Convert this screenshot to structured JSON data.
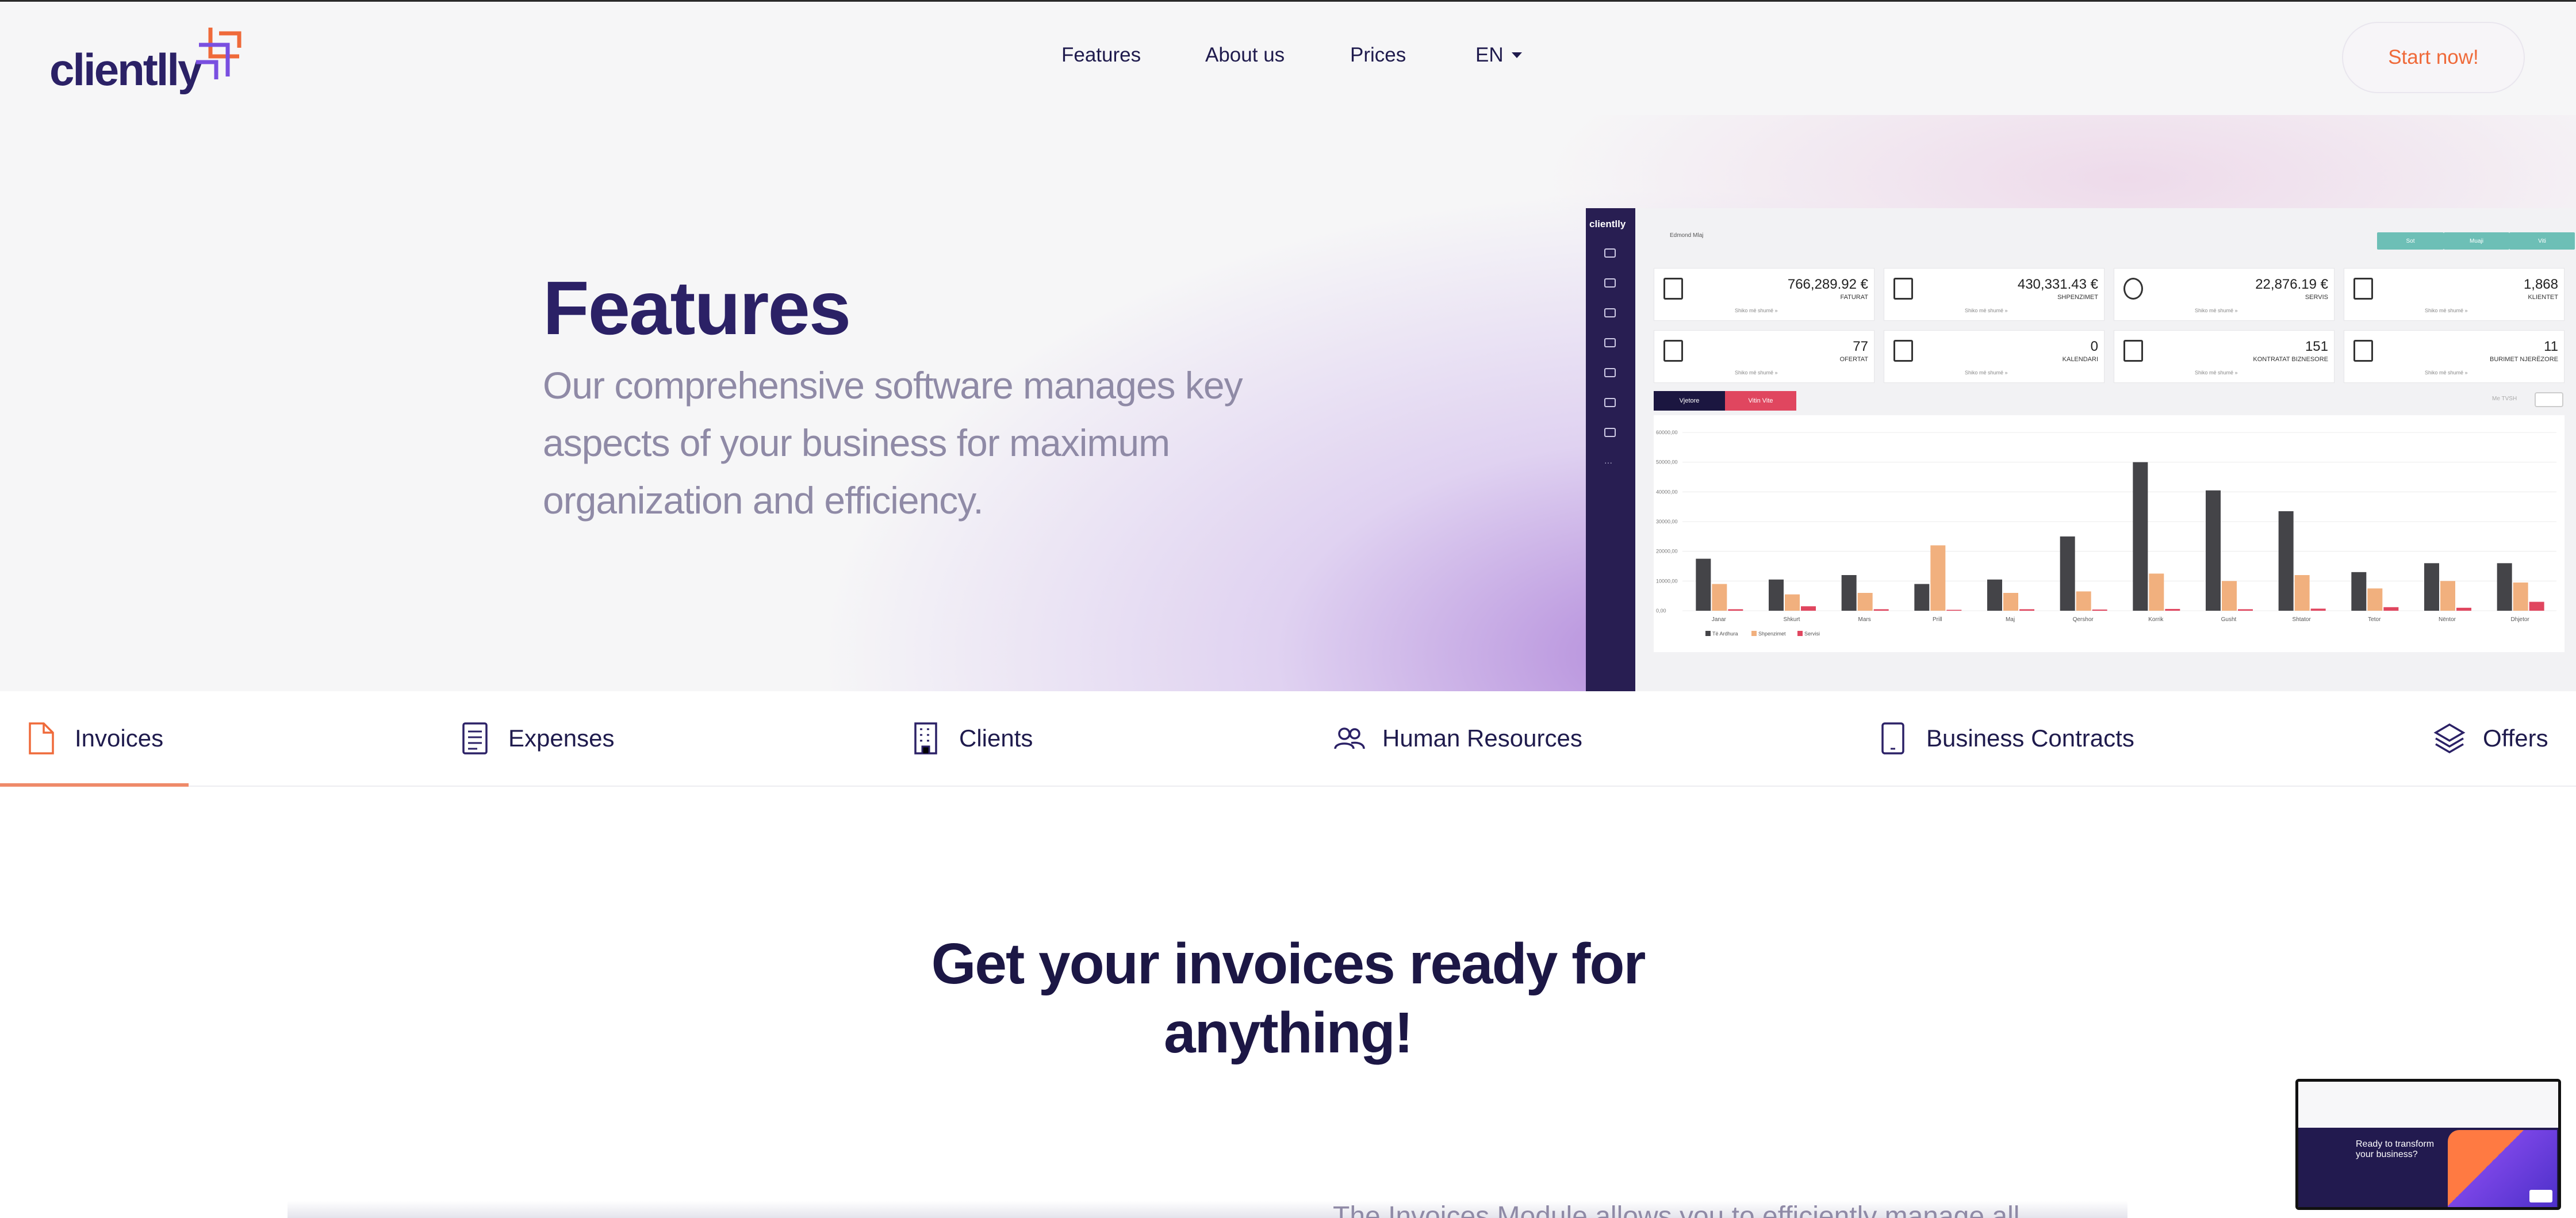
{
  "header": {
    "logo_text": "clientlly",
    "nav": [
      "Features",
      "About us",
      "Prices"
    ],
    "language": "EN",
    "cta_label": "Start now!"
  },
  "hero": {
    "title": "Features",
    "subtitle": "Our comprehensive software manages key aspects of your business for maximum organization and efficiency."
  },
  "dashboard": {
    "logo_text": "clientlly",
    "user_name": "Edmond Mlaj",
    "top_buttons": [
      "Sot",
      "Muaji",
      "Viti"
    ],
    "stats": [
      {
        "value": "766,289.92 €",
        "label": "FATURAT",
        "link": "Shiko më shumë »",
        "icon": "invoice-icon"
      },
      {
        "value": "430,331.43 €",
        "label": "SHPENZIMET",
        "link": "Shiko më shumë »",
        "icon": "wallet-icon"
      },
      {
        "value": "22,876.19 €",
        "label": "SERVIS",
        "link": "Shiko më shumë »",
        "icon": "gear-icon"
      },
      {
        "value": "1,868",
        "label": "KLIENTET",
        "link": "Shiko më shumë »",
        "icon": "building-icon"
      },
      {
        "value": "77",
        "label": "OFERTAT",
        "link": "Shiko më shumë »",
        "icon": "offer-icon"
      },
      {
        "value": "0",
        "label": "KALENDARI",
        "link": "Shiko më shumë »",
        "icon": "calendar-icon"
      },
      {
        "value": "151",
        "label": "KONTRATAT BIZNESORE",
        "link": "Shiko më shumë »",
        "icon": "contract-icon"
      },
      {
        "value": "11",
        "label": "BURIMET NJERËZORE",
        "link": "Shiko më shumë »",
        "icon": "id-card-icon"
      }
    ],
    "tabs": [
      "Vjetore",
      "Vitin Vite"
    ],
    "toggle_label": "Me TVSH"
  },
  "chart_data": {
    "type": "bar",
    "categories": [
      "Janar",
      "Shkurt",
      "Mars",
      "Prill",
      "Maj",
      "Qershor",
      "Korrik",
      "Gusht",
      "Shtator",
      "Tetor",
      "Nëntor",
      "Dhjetor"
    ],
    "y_ticks": [
      "0,00",
      "10000,00",
      "20000,00",
      "30000,00",
      "40000,00",
      "50000,00",
      "60000,00"
    ],
    "ylim": [
      0,
      60000
    ],
    "series": [
      {
        "name": "Të Ardhura",
        "color": "#444448",
        "values": [
          17500,
          10500,
          12000,
          9000,
          10500,
          25000,
          50000,
          40500,
          33500,
          13000,
          16000,
          16000
        ]
      },
      {
        "name": "Shpenzimet",
        "color": "#f1b07e",
        "values": [
          9000,
          5500,
          6000,
          22000,
          6000,
          6500,
          12500,
          10000,
          12000,
          7500,
          10000,
          9500
        ]
      },
      {
        "name": "Servisi",
        "color": "#e0465f",
        "values": [
          500,
          1500,
          500,
          300,
          500,
          400,
          600,
          500,
          700,
          1200,
          1000,
          3000
        ]
      }
    ],
    "legend_position": "bottom-left"
  },
  "tabs": [
    {
      "label": "Invoices",
      "icon": "document-icon"
    },
    {
      "label": "Expenses",
      "icon": "receipt-icon"
    },
    {
      "label": "Clients",
      "icon": "building-icon"
    },
    {
      "label": "Human Resources",
      "icon": "users-icon"
    },
    {
      "label": "Business Contracts",
      "icon": "tablet-icon"
    },
    {
      "label": "Offers",
      "icon": "layers-icon"
    }
  ],
  "content": {
    "title_line1": "Get your invoices ready for",
    "title_line2": "anything!",
    "partial_text": "The Invoices Module allows you to efficiently manage all"
  },
  "preview": {
    "text": "Ready to transform your business?"
  },
  "colors": {
    "brand_dark": "#2b2166",
    "accent_orange": "#ef6a3a",
    "muted_text": "#8f8aa6"
  }
}
